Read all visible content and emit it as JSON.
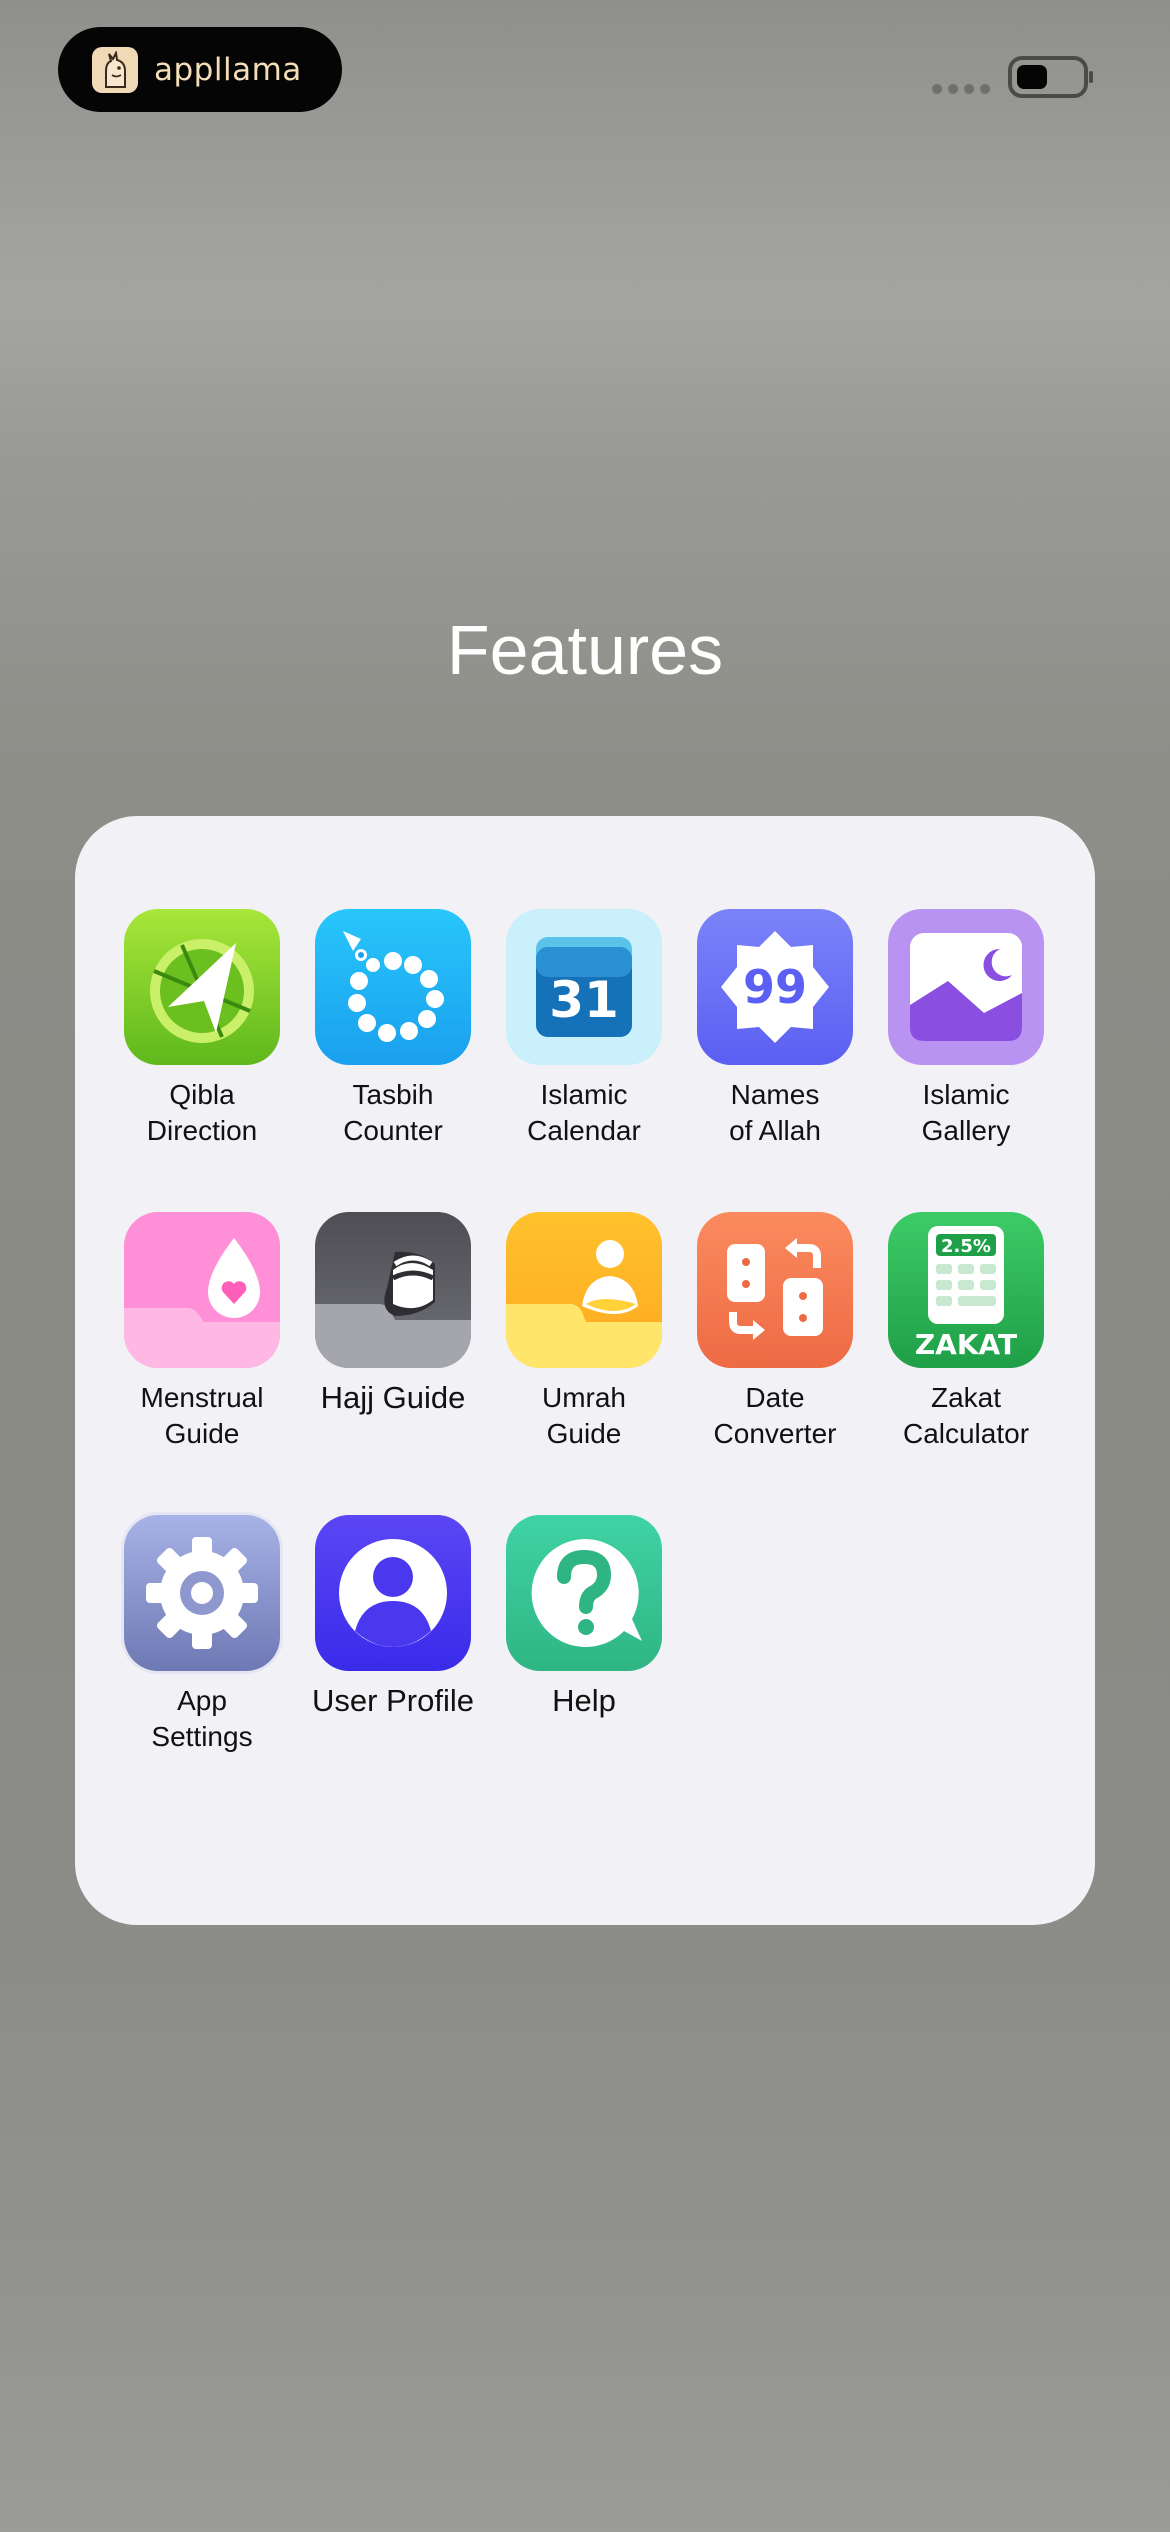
{
  "status_bar": {
    "brand": "appllama",
    "logo_icon": "llama-icon"
  },
  "title": "Features",
  "features": [
    {
      "label": "Qibla\nDirection",
      "icon": "compass-icon",
      "color": "#7ed321"
    },
    {
      "label": "Tasbih\nCounter",
      "icon": "prayer-beads-icon",
      "color": "#1fb8f5"
    },
    {
      "label": "Islamic\nCalendar",
      "icon": "calendar-icon",
      "color": "#1975c0",
      "day": "31"
    },
    {
      "label": "Names\nof Allah",
      "icon": "badge-99-icon",
      "color": "#6a6ef7",
      "number": "99"
    },
    {
      "label": "Islamic\nGallery",
      "icon": "gallery-icon",
      "color": "#b48bf0"
    },
    {
      "label": "Menstrual\nGuide",
      "icon": "drop-heart-icon",
      "color": "#ff8ed3"
    },
    {
      "label": "Hajj Guide",
      "icon": "kaaba-icon",
      "color": "#5a5a60"
    },
    {
      "label": "Umrah\nGuide",
      "icon": "pilgrim-icon",
      "color": "#ffb82a"
    },
    {
      "label": "Date\nConverter",
      "icon": "convert-icon",
      "color": "#f57d55"
    },
    {
      "label": "Zakat\nCalculator",
      "icon": "calculator-icon",
      "color": "#2bb357",
      "percent": "2.5%",
      "word": "ZAKAT"
    },
    {
      "label": "App\nSettings",
      "icon": "gear-icon",
      "color": "#7f8bc4"
    },
    {
      "label": "User Profile",
      "icon": "user-icon",
      "color": "#4f3ef2"
    },
    {
      "label": "Help",
      "icon": "help-bubble-icon",
      "color": "#3bc79b"
    }
  ]
}
